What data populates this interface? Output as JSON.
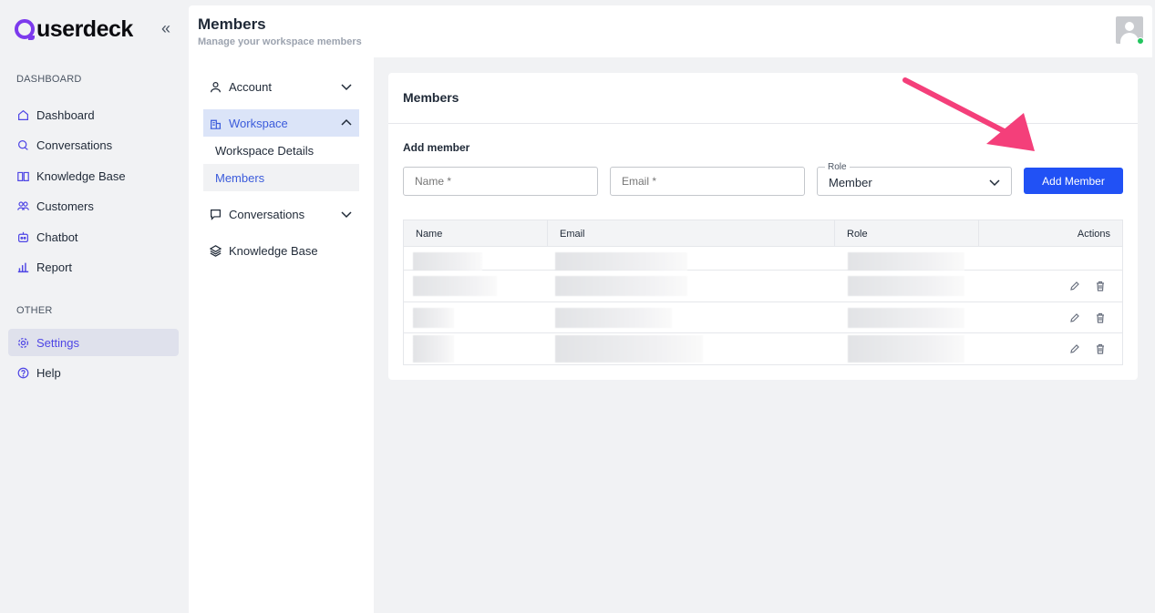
{
  "app": {
    "logo": "userdeck",
    "collapse_icon": "double-chevron-left-icon"
  },
  "sidebar": {
    "sections": [
      {
        "label": "DASHBOARD"
      },
      {
        "label": "OTHER"
      }
    ],
    "items": [
      {
        "label": "Dashboard",
        "icon": "home-icon"
      },
      {
        "label": "Conversations",
        "icon": "chat-icon"
      },
      {
        "label": "Knowledge Base",
        "icon": "book-icon"
      },
      {
        "label": "Customers",
        "icon": "users-icon"
      },
      {
        "label": "Chatbot",
        "icon": "bot-icon"
      },
      {
        "label": "Report",
        "icon": "bar-chart-icon"
      },
      {
        "label": "Settings",
        "icon": "gear-icon",
        "active": true
      },
      {
        "label": "Help",
        "icon": "help-circle-icon"
      }
    ]
  },
  "header": {
    "title": "Members",
    "subtitle": "Manage your workspace members",
    "avatar_status_color": "#22c55e"
  },
  "subnav": {
    "account": "Account",
    "workspace": "Workspace",
    "workspace_children": [
      "Workspace Details",
      "Members"
    ],
    "conversations": "Conversations",
    "knowledge_base": "Knowledge Base"
  },
  "card": {
    "title": "Members",
    "add_member_label": "Add member",
    "name_placeholder": "Name *",
    "email_placeholder": "Email *",
    "role_legend": "Role",
    "role_value": "Member",
    "add_button": "Add Member"
  },
  "table": {
    "columns": [
      "Name",
      "Email",
      "Role",
      "Actions"
    ],
    "row_count": 4
  },
  "colors": {
    "brand": "#7c3aed",
    "primary_button": "#2151f5",
    "active_link": "#3b5bdb",
    "annotation_arrow": "#f43f7a"
  }
}
